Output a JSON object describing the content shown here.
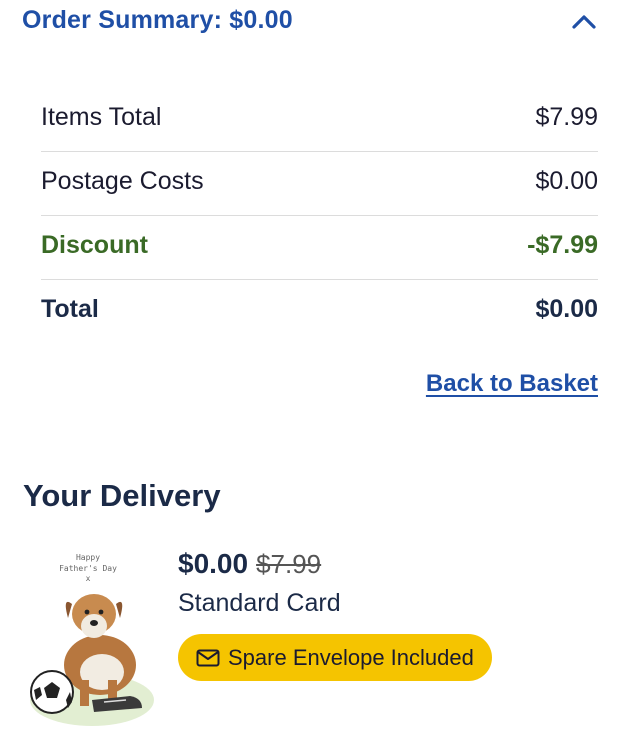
{
  "summary": {
    "title": "Order Summary: $0.00",
    "rows": [
      {
        "label": "Items Total",
        "value": "$7.99"
      },
      {
        "label": "Postage Costs",
        "value": "$0.00"
      },
      {
        "label": "Discount",
        "value": "-$7.99"
      },
      {
        "label": "Total",
        "value": "$0.00"
      }
    ],
    "back_link": "Back to Basket"
  },
  "delivery": {
    "heading": "Your Delivery",
    "item": {
      "price_now": "$0.00",
      "price_old": "$7.99",
      "name": "Standard Card",
      "badge": "Spare Envelope Included",
      "card_text_line1": "Happy",
      "card_text_line2": "Father's Day",
      "card_text_line3": "x"
    }
  },
  "colors": {
    "accent_blue": "#1f4fa6",
    "discount_green": "#3a6a26",
    "badge_yellow": "#f5c400",
    "dark_navy": "#1b2a47"
  },
  "icons": [
    "chevron-up-icon",
    "envelope-icon"
  ]
}
